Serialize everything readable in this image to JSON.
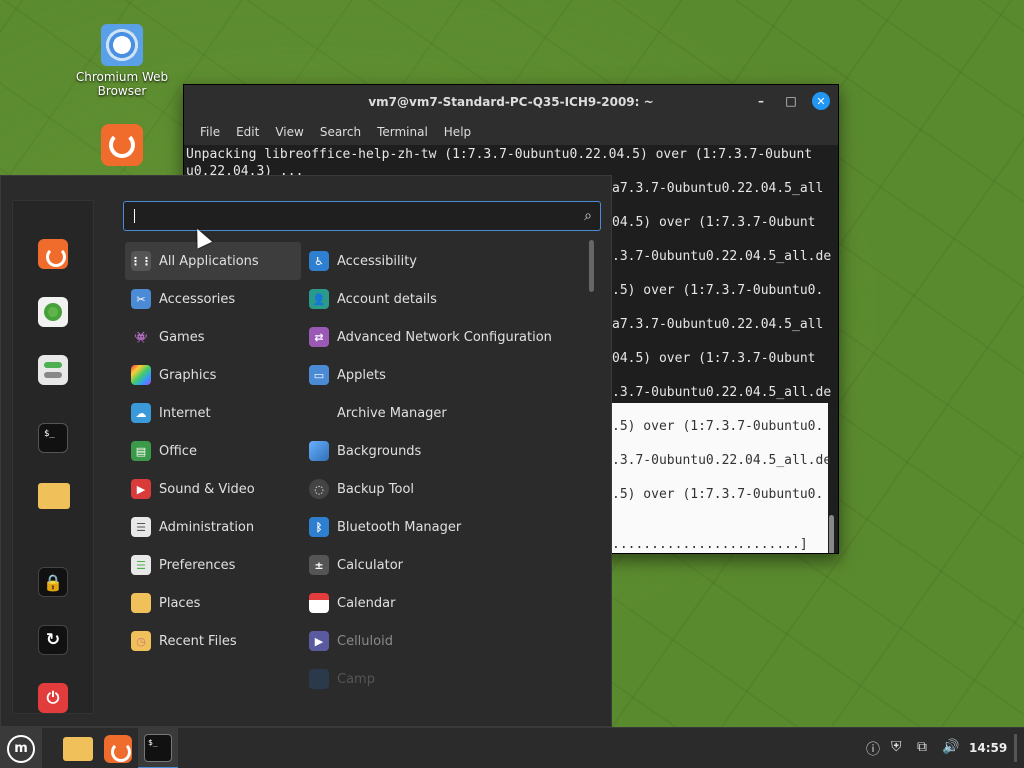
{
  "desktop": {
    "icons": [
      {
        "label": "Chromium Web Browser"
      },
      {
        "label": ""
      }
    ]
  },
  "terminal": {
    "title": "vm7@vm7-Standard-PC-Q35-ICH9-2009: ~",
    "menu": [
      "File",
      "Edit",
      "View",
      "Search",
      "Terminal",
      "Help"
    ],
    "line1": "Unpacking libreoffice-help-zh-tw (1:7.3.7-0ubuntu0.22.04.5) over (1:7.3.7-0ubunt",
    "line2": "u0.22.04.3) ...",
    "right_lines": [
      "a7.3.7-0ubuntu0.22.04.5_all",
      "04.5) over (1:7.3.7-0ubunt",
      ".3.7-0ubuntu0.22.04.5_all.de",
      ".5) over (1:7.3.7-0ubuntu0.",
      "a7.3.7-0ubuntu0.22.04.5_all",
      "04.5) over (1:7.3.7-0ubunt",
      ".3.7-0ubuntu0.22.04.5_all.de"
    ],
    "white_lines": [
      ".5) over (1:7.3.7-0ubuntu0.",
      ".3.7-0ubuntu0.22.04.5_all.de",
      ".5) over (1:7.3.7-0ubuntu0.",
      "",
      "........................]"
    ]
  },
  "menu": {
    "search_value": "",
    "categories": [
      {
        "label": "All Applications",
        "icon": "grid-icon",
        "color": "#555555"
      },
      {
        "label": "Accessories",
        "icon": "scissors-icon",
        "color": "#4b8bd6"
      },
      {
        "label": "Games",
        "icon": "gamepad-icon",
        "color": "#333333"
      },
      {
        "label": "Graphics",
        "icon": "palette-icon",
        "color": "#c04aa0"
      },
      {
        "label": "Internet",
        "icon": "cloud-icon",
        "color": "#3a9ad9"
      },
      {
        "label": "Office",
        "icon": "document-icon",
        "color": "#3b9a4a"
      },
      {
        "label": "Sound & Video",
        "icon": "play-icon",
        "color": "#d93a3a"
      },
      {
        "label": "Administration",
        "icon": "toggles-icon",
        "color": "#e8e8e8"
      },
      {
        "label": "Preferences",
        "icon": "toggles-icon",
        "color": "#e8e8e8"
      },
      {
        "label": "Places",
        "icon": "folder-icon",
        "color": "#f0c05a"
      },
      {
        "label": "Recent Files",
        "icon": "folder-clock-icon",
        "color": "#f0c05a"
      }
    ],
    "applications": [
      {
        "label": "Accessibility",
        "icon": "accessibility-icon",
        "color": "#2f7fd1"
      },
      {
        "label": "Account details",
        "icon": "account-icon",
        "color": "#2a9a8a"
      },
      {
        "label": "Advanced Network Configuration",
        "icon": "network-icon",
        "color": "#9b59b6"
      },
      {
        "label": "Applets",
        "icon": "applets-icon",
        "color": "#4b8bd6"
      },
      {
        "label": "Archive Manager",
        "icon": "",
        "color": "#2b2b2b"
      },
      {
        "label": "Backgrounds",
        "icon": "backgrounds-icon",
        "color": "#4b8bd6"
      },
      {
        "label": "Backup Tool",
        "icon": "backup-icon",
        "color": "#444444"
      },
      {
        "label": "Bluetooth Manager",
        "icon": "bluetooth-icon",
        "color": "#2f7fd1"
      },
      {
        "label": "Calculator",
        "icon": "calculator-icon",
        "color": "#555555"
      },
      {
        "label": "Calendar",
        "icon": "calendar-icon",
        "color": "#e23c3c"
      },
      {
        "label": "Celluloid",
        "icon": "celluloid-icon",
        "color": "#5a5aa0"
      },
      {
        "label": "Camp",
        "icon": "camera-icon",
        "color": "#335"
      }
    ]
  },
  "taskbar": {
    "clock": "14:59"
  }
}
